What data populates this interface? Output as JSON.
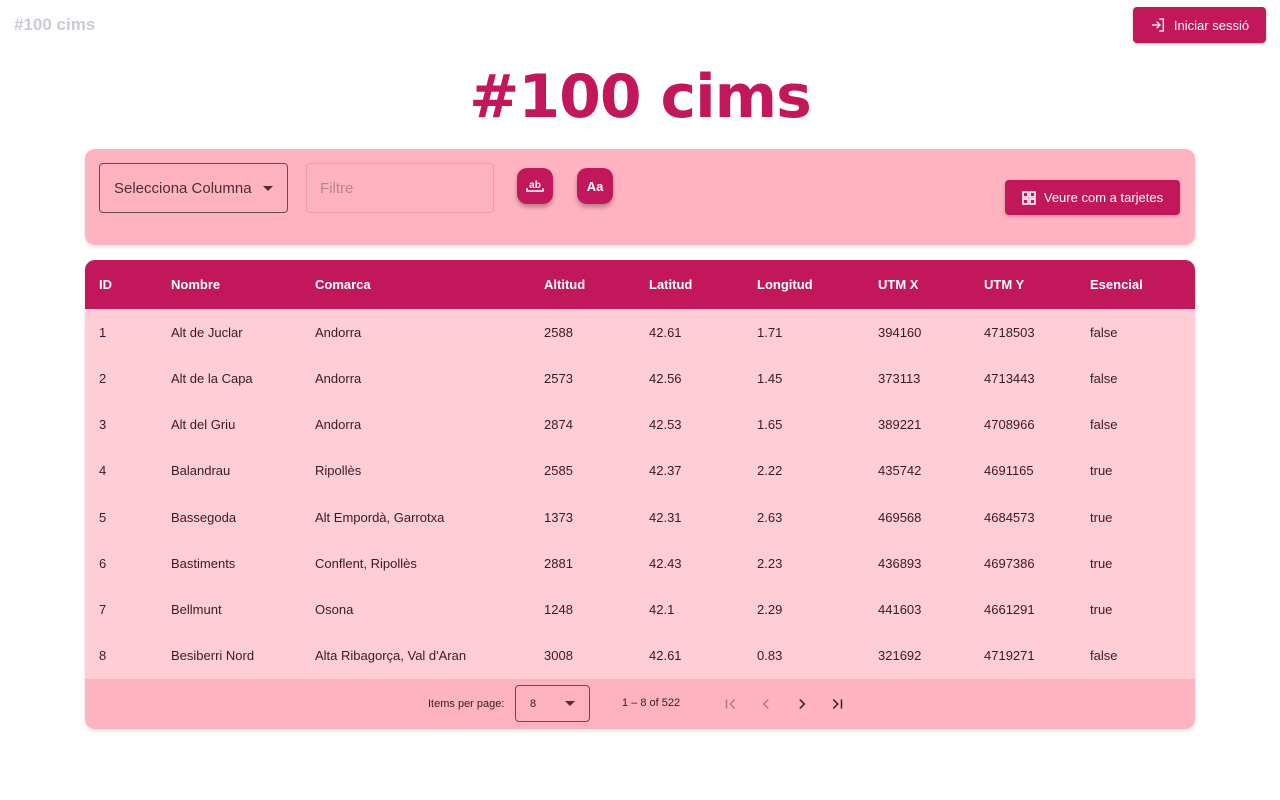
{
  "header": {
    "brand": "#100 cims",
    "login_label": "Iniciar sessió"
  },
  "hero": {
    "title": "#100 cims"
  },
  "filters": {
    "column_select_value": "Selecciona Columna",
    "filter_placeholder": "Filtre",
    "toggle_ab_label": "ab",
    "toggle_case_label": "Aa",
    "cards_button_label": "Veure com a tarjetes"
  },
  "table": {
    "columns": [
      "ID",
      "Nombre",
      "Comarca",
      "Altitud",
      "Latitud",
      "Longitud",
      "UTM X",
      "UTM Y",
      "Esencial"
    ],
    "rows": [
      [
        "1",
        "Alt de Juclar",
        "Andorra",
        "2588",
        "42.61",
        "1.71",
        "394160",
        "4718503",
        "false"
      ],
      [
        "2",
        "Alt de la Capa",
        "Andorra",
        "2573",
        "42.56",
        "1.45",
        "373113",
        "4713443",
        "false"
      ],
      [
        "3",
        "Alt del Griu",
        "Andorra",
        "2874",
        "42.53",
        "1.65",
        "389221",
        "4708966",
        "false"
      ],
      [
        "4",
        "Balandrau",
        "Ripollès",
        "2585",
        "42.37",
        "2.22",
        "435742",
        "4691165",
        "true"
      ],
      [
        "5",
        "Bassegoda",
        "Alt Empordà, Garrotxa",
        "1373",
        "42.31",
        "2.63",
        "469568",
        "4684573",
        "true"
      ],
      [
        "6",
        "Bastiments",
        "Conflent, Ripollès",
        "2881",
        "42.43",
        "2.23",
        "436893",
        "4697386",
        "true"
      ],
      [
        "7",
        "Bellmunt",
        "Osona",
        "1248",
        "42.1",
        "2.29",
        "441603",
        "4661291",
        "true"
      ],
      [
        "8",
        "Besiberri Nord",
        "Alta Ribagorça, Val d'Aran",
        "3008",
        "42.61",
        "0.83",
        "321692",
        "4719271",
        "false"
      ]
    ]
  },
  "paginator": {
    "items_per_page_label": "Items per page:",
    "items_per_page_value": "8",
    "range_label": "1 – 8 of 522"
  },
  "colors": {
    "accent": "#c2185b",
    "panel": "#ffb3c1",
    "row_bg": "#ffcdd6",
    "brand_muted": "#c9ccd3"
  }
}
